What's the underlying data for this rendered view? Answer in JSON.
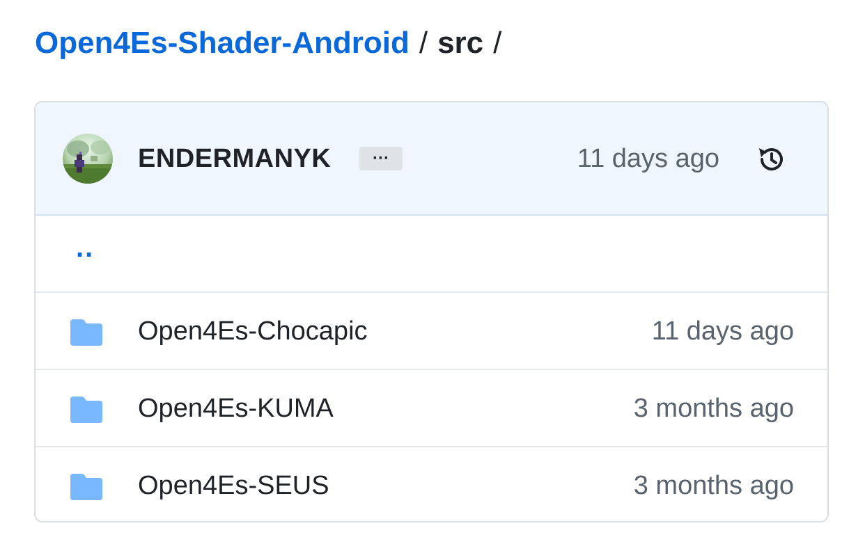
{
  "breadcrumb": {
    "repo": "Open4Es-Shader-Android",
    "separator": "/",
    "dir": "src",
    "trailing": "/"
  },
  "commit": {
    "author": "ENDERMANYK",
    "ellipsis": "···",
    "time": "11 days ago",
    "history_icon": "history-icon"
  },
  "parent": {
    "label": ".."
  },
  "items": [
    {
      "name": "Open4Es-Chocapic",
      "time": "11 days ago",
      "icon": "folder-icon"
    },
    {
      "name": "Open4Es-KUMA",
      "time": "3 months ago",
      "icon": "folder-icon"
    },
    {
      "name": "Open4Es-SEUS",
      "time": "3 months ago",
      "icon": "folder-icon"
    }
  ],
  "colors": {
    "link": "#0969da",
    "folder": "#79b8ff",
    "header_bg": "#f0f6ff",
    "muted_text": "#59636e"
  }
}
